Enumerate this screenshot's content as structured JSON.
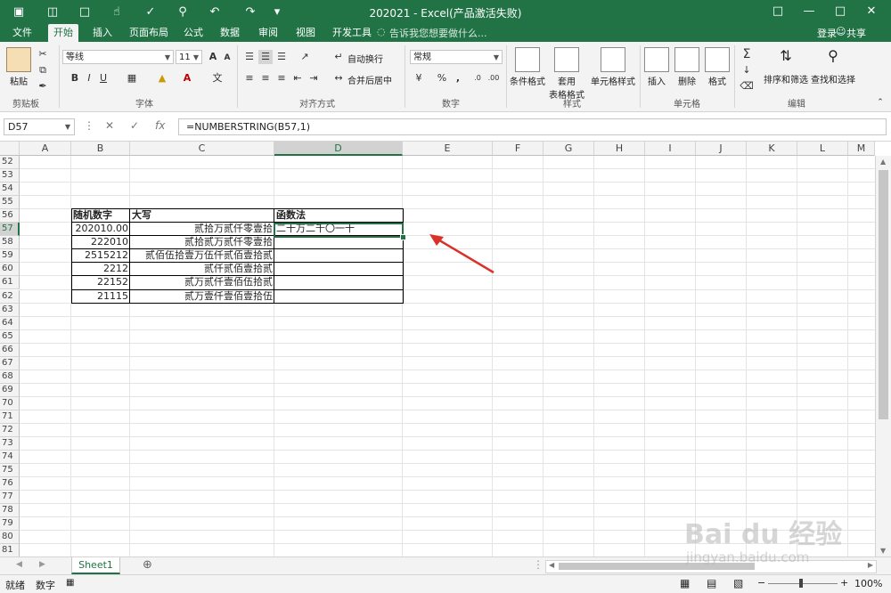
{
  "window": {
    "title": "202021 - Excel(产品激活失败)",
    "controls": [
      "restore-icon",
      "minimize-icon",
      "maximize-icon",
      "close-icon"
    ]
  },
  "menu": {
    "items": [
      "文件",
      "开始",
      "插入",
      "页面布局",
      "公式",
      "数据",
      "审阅",
      "视图",
      "开发工具"
    ],
    "active": "开始",
    "search_hint": "告诉我您想要做什么...",
    "login": "登录",
    "share": "共享"
  },
  "ribbon": {
    "clipboard": {
      "paste": "粘贴",
      "group": "剪贴板"
    },
    "font": {
      "name": "等线",
      "size": "11",
      "group": "字体",
      "bold": "B",
      "italic": "I",
      "underline": "U",
      "grow": "A",
      "shrink": "A"
    },
    "align": {
      "wrap": "自动换行",
      "merge": "合并后居中",
      "group": "对齐方式"
    },
    "number": {
      "format": "常规",
      "percent": "%",
      "comma": ",",
      "group": "数字"
    },
    "styles": {
      "cond": "条件格式",
      "table1": "套用",
      "table2": "表格格式",
      "cell": "单元格样式",
      "group": "样式"
    },
    "cells": {
      "insert": "插入",
      "delete": "删除",
      "format": "格式",
      "group": "单元格"
    },
    "editing": {
      "sort": "排序和筛选",
      "find": "查找和选择",
      "group": "编辑"
    }
  },
  "formula_bar": {
    "name_box": "D57",
    "fx": "fx",
    "formula": "=NUMBERSTRING(B57,1)"
  },
  "columns": [
    "A",
    "B",
    "C",
    "D",
    "E",
    "F",
    "G",
    "H",
    "I",
    "J",
    "K",
    "L",
    "M"
  ],
  "rows": [
    "52",
    "53",
    "54",
    "55",
    "56",
    "57",
    "58",
    "59",
    "60",
    "61",
    "62",
    "63",
    "64",
    "65",
    "66",
    "67",
    "68",
    "69",
    "70",
    "71",
    "72",
    "73",
    "74",
    "75",
    "76",
    "77",
    "78",
    "79",
    "80",
    "81"
  ],
  "table": {
    "headers": [
      "随机数字",
      "大写",
      "函数法"
    ],
    "rows": [
      [
        "202010.00",
        "贰拾万贰仟零壹拾",
        "二十万二千〇一十"
      ],
      [
        "222010",
        "贰拾贰万贰仟零壹拾",
        ""
      ],
      [
        "2515212",
        "贰佰伍拾壹万伍仟贰佰壹拾贰",
        ""
      ],
      [
        "2212",
        "贰仟贰佰壹拾贰",
        ""
      ],
      [
        "22152",
        "贰万贰仟壹佰伍拾贰",
        ""
      ],
      [
        "21115",
        "贰万壹仟壹佰壹拾伍",
        ""
      ]
    ]
  },
  "sheets": [
    "Sheet1"
  ],
  "status": {
    "ready": "就绪",
    "mode": "数字",
    "zoom": "100%"
  },
  "watermark": {
    "line1": "Bai du 经验",
    "line2": "jingyan.baidu.com"
  },
  "colors": {
    "brand": "#217346",
    "arrow": "#d9322a"
  }
}
